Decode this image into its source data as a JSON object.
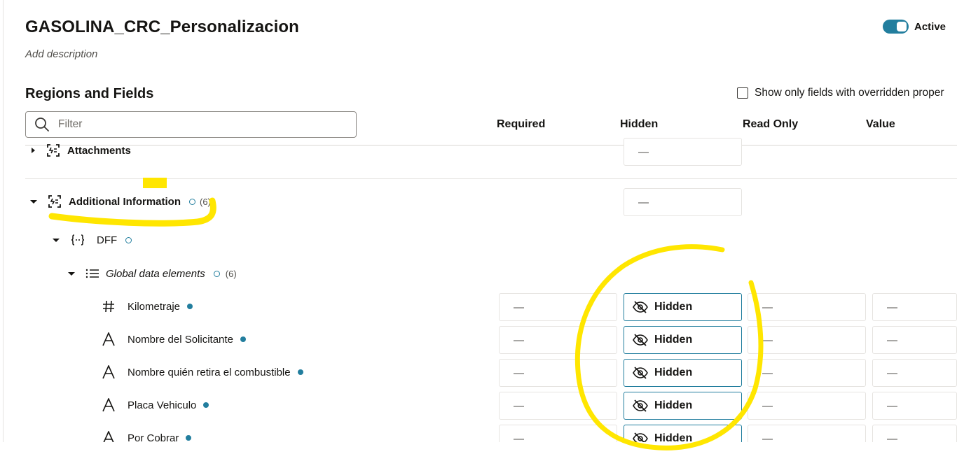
{
  "page": {
    "title": "GASOLINA_CRC_Personalizacion",
    "description": "Add description",
    "active_label": "Active",
    "section_title": "Regions and Fields",
    "override_label": "Show only fields with overridden proper",
    "filter_placeholder": "Filter"
  },
  "columns": {
    "required": "Required",
    "hidden": "Hidden",
    "read_only": "Read Only",
    "value": "Value"
  },
  "tree": {
    "attachments": {
      "label": "Attachments",
      "icon": "region-icon",
      "hidden_value": "—"
    },
    "additional_info": {
      "label": "Additional Information",
      "count": "(6)",
      "icon": "region-icon",
      "hidden_value": "—"
    },
    "dff": {
      "label": "DFF",
      "icon": "braces-icon"
    },
    "global": {
      "label": "Global data elements",
      "count": "(6)",
      "icon": "list-icon"
    }
  },
  "fields": [
    {
      "label": "Kilometraje",
      "type_icon": "hash-icon",
      "required": "—",
      "hidden": "Hidden",
      "read_only": "—",
      "value": "—"
    },
    {
      "label": "Nombre del Solicitante",
      "type_icon": "text-icon",
      "required": "—",
      "hidden": "Hidden",
      "read_only": "—",
      "value": "—"
    },
    {
      "label": "Nombre quién retira el combustible",
      "type_icon": "text-icon",
      "required": "—",
      "hidden": "Hidden",
      "read_only": "—",
      "value": "—"
    },
    {
      "label": "Placa Vehiculo",
      "type_icon": "text-icon",
      "required": "—",
      "hidden": "Hidden",
      "read_only": "—",
      "value": "—"
    },
    {
      "label": "Por Cobrar",
      "type_icon": "text-icon",
      "required": "—",
      "hidden": "Hidden",
      "read_only": "—",
      "value": "—"
    }
  ],
  "colors": {
    "accent": "#227e9e",
    "highlighter": "#ffe600"
  }
}
